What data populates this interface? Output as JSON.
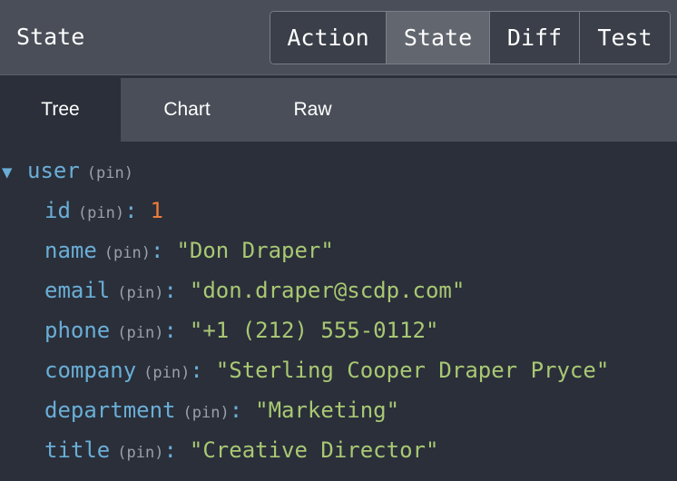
{
  "header": {
    "title": "State",
    "modes": [
      {
        "label": "Action",
        "active": false
      },
      {
        "label": "State",
        "active": true
      },
      {
        "label": "Diff",
        "active": false
      },
      {
        "label": "Test",
        "active": false
      }
    ]
  },
  "tabs": [
    {
      "label": "Tree",
      "active": true
    },
    {
      "label": "Chart",
      "active": false
    },
    {
      "label": "Raw",
      "active": false
    }
  ],
  "tree": {
    "expand_icon": "triangle-down-icon",
    "root": {
      "key": "user",
      "pin": "(pin)"
    },
    "fields": [
      {
        "key": "id",
        "pin": "(pin)",
        "colon": ":",
        "value": "1",
        "type": "number"
      },
      {
        "key": "name",
        "pin": "(pin)",
        "colon": ":",
        "value": "\"Don Draper\"",
        "type": "string"
      },
      {
        "key": "email",
        "pin": "(pin)",
        "colon": ":",
        "value": "\"don.draper@scdp.com\"",
        "type": "string"
      },
      {
        "key": "phone",
        "pin": "(pin)",
        "colon": ":",
        "value": "\"+1 (212) 555-0112\"",
        "type": "string"
      },
      {
        "key": "company",
        "pin": "(pin)",
        "colon": ":",
        "value": "\"Sterling Cooper Draper Pryce\"",
        "type": "string"
      },
      {
        "key": "department",
        "pin": "(pin)",
        "colon": ":",
        "value": "\"Marketing\"",
        "type": "string"
      },
      {
        "key": "title",
        "pin": "(pin)",
        "colon": ":",
        "value": "\"Creative Director\"",
        "type": "string"
      }
    ]
  },
  "colors": {
    "background": "#2a2f3a",
    "header": "#4a4e58",
    "key": "#6aaed6",
    "number": "#ee7b3a",
    "string": "#a9c872",
    "pin": "#9aa0ab"
  }
}
